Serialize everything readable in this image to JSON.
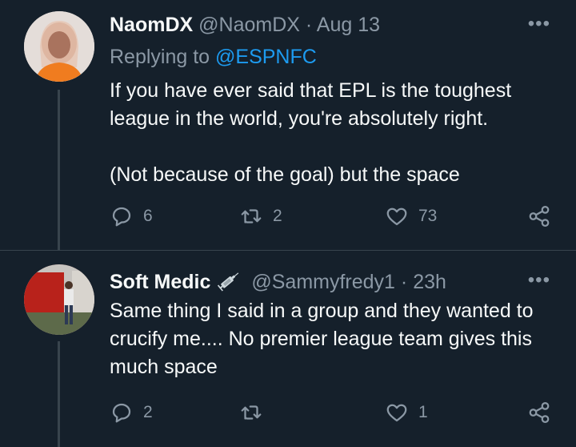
{
  "tweets": [
    {
      "name": "NaomDX",
      "handle": "@NaomDX",
      "separator": "·",
      "time": "Aug 13",
      "more": "•••",
      "replying_prefix": "Replying to",
      "replying_handle": "@ESPNFC",
      "text_line1": "If you have ever said that EPL is the toughest",
      "text_line2": "league in the world, you're absolutely right.",
      "text_line3": "(Not because of the goal) but the space",
      "counts": {
        "replies": "6",
        "retweets": "2",
        "likes": "73"
      }
    },
    {
      "name": "Soft Medic",
      "handle": "@Sammyfredy1",
      "separator": "·",
      "time": "23h",
      "more": "•••",
      "text_line1": "Same thing I said in a group and they wanted to",
      "text_line2": "crucify me.... No premier league team gives this",
      "text_line3": "much space",
      "counts": {
        "replies": "2",
        "retweets": "",
        "likes": "1"
      }
    }
  ],
  "colors": {
    "background": "#15202b",
    "text": "#f7f9f9",
    "muted": "#8b98a5",
    "link": "#1d9bf0",
    "divider": "#38444d"
  },
  "icons": [
    "reply-icon",
    "retweet-icon",
    "like-icon",
    "share-icon",
    "more-icon",
    "syringe-icon"
  ]
}
